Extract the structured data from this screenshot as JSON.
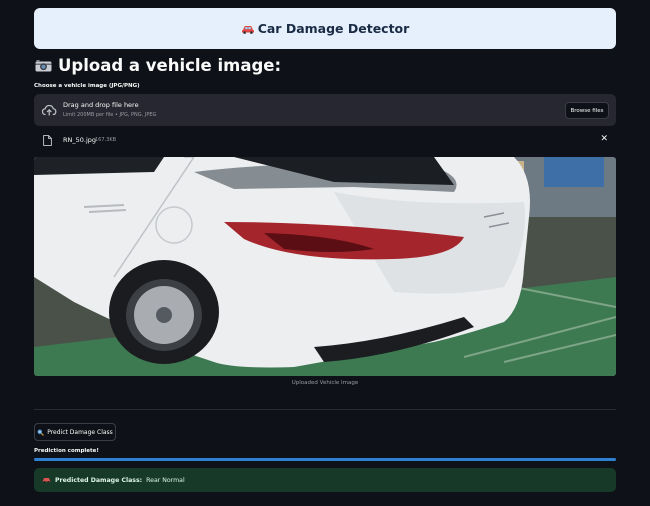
{
  "banner": {
    "icon": "car-icon",
    "title": "Car Damage Detector"
  },
  "heading": {
    "icon": "camera-icon",
    "text": "Upload a vehicle image:"
  },
  "uploader": {
    "label": "Choose a vehicle image (JPG/PNG)",
    "drop_title": "Drag and drop file here",
    "drop_subtitle": "Limit 200MB per file • JPG, PNG, JPEG",
    "browse_label": "Browse files"
  },
  "file": {
    "name": "RN_50.jpg",
    "size": "167.3KB"
  },
  "image": {
    "caption": "Uploaded Vehicle Image"
  },
  "predict_button": {
    "icon": "magnifier-icon",
    "label": "Predict Damage Class"
  },
  "status": {
    "text": "Prediction complete!",
    "progress": 1.0
  },
  "result": {
    "icon": "car-icon",
    "label": "Predicted Damage Class:",
    "value": "Rear Normal"
  },
  "colors": {
    "background": "#0e1117",
    "banner": "#e6f0fc",
    "progress": "#2f80d1",
    "success_bg": "#173928"
  }
}
